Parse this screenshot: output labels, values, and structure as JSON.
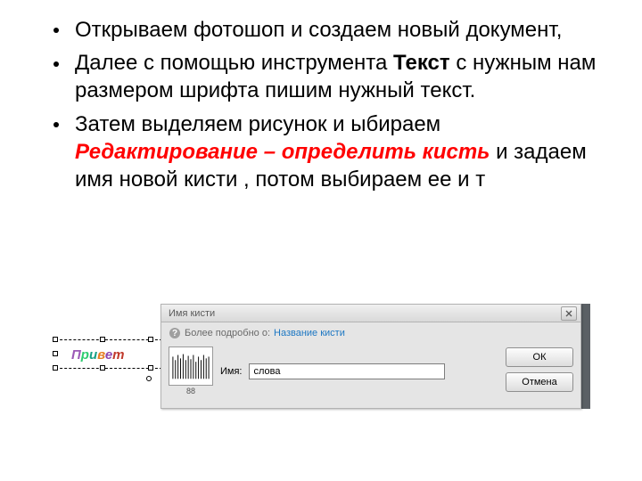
{
  "bullets": [
    {
      "parts": [
        {
          "text": "Открываем фотошоп и создаем новый документ,",
          "style": "plain"
        }
      ]
    },
    {
      "parts": [
        {
          "text": "Далее с помощью инструмента ",
          "style": "plain"
        },
        {
          "text": "Текст",
          "style": "bold"
        },
        {
          "text": " с нужным нам размером шрифта пишим нужный текст.",
          "style": "plain"
        }
      ]
    },
    {
      "parts": [
        {
          "text": "Затем выделяем рисунок и ыбираем ",
          "style": "plain"
        },
        {
          "text": "Редактирование – определить кисть",
          "style": "em-red"
        },
        {
          "text": " и задаем имя новой кисти , потом выбираем ее и т",
          "style": "plain"
        }
      ]
    }
  ],
  "selection_text": "Привет",
  "dialog": {
    "title": "Имя кисти",
    "more_text": "Более подробно о:",
    "link_text": "Название кисти",
    "name_label": "Имя:",
    "name_value": "слова",
    "preview_size": "88",
    "buttons": {
      "ok": "ОК",
      "cancel": "Отмена"
    }
  }
}
